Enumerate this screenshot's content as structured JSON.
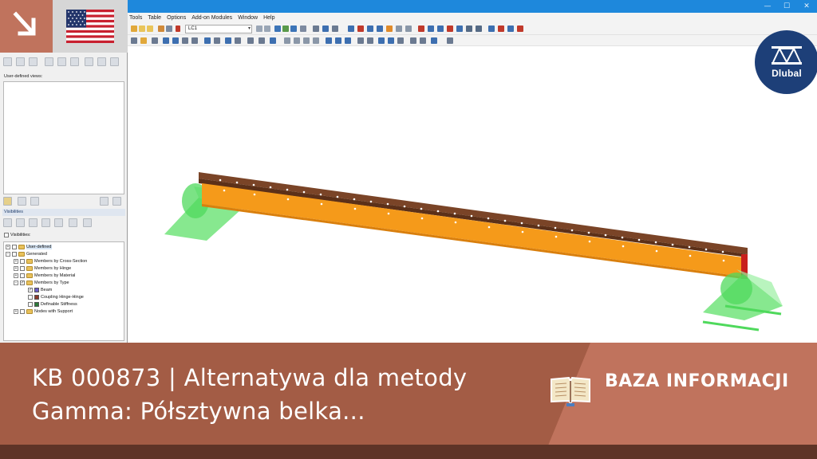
{
  "window": {
    "controls": {
      "minimize": "—",
      "maximize": "☐",
      "close": "✕"
    }
  },
  "menu": {
    "items": [
      "Tools",
      "Table",
      "Options",
      "Add-on Modules",
      "Window",
      "Help"
    ]
  },
  "toolbar": {
    "load_case": "LC1"
  },
  "navigator": {
    "user_defined_views_label": "User-defined views:",
    "visibilities_header": "Visibilities",
    "visibilities_label": "Visibilities:",
    "tree": [
      "User-defined",
      "Generated",
      "Members by Cross-Section",
      "Members by Hinge",
      "Members by Material",
      "Members by Type",
      "Beam",
      "Coupling Hinge-Hinge",
      "Definable Stiffness",
      "Nodes with Support"
    ]
  },
  "logo": {
    "text": "Dlubal"
  },
  "banner": {
    "title": "KB 000873 | Alternatywa dla metody Gamma: Półsztywna belka...",
    "category": "BAZA INFORMACJI"
  },
  "colors": {
    "titlebar": "#1e88dc",
    "accent": "#c0735d",
    "banner_left": "#a35c45",
    "banner_right": "#c0735d",
    "beam_orange": "#f59a1a",
    "beam_top": "#7a4427",
    "support_green": "#5fe06a",
    "logo_navy": "#1d3f78"
  }
}
